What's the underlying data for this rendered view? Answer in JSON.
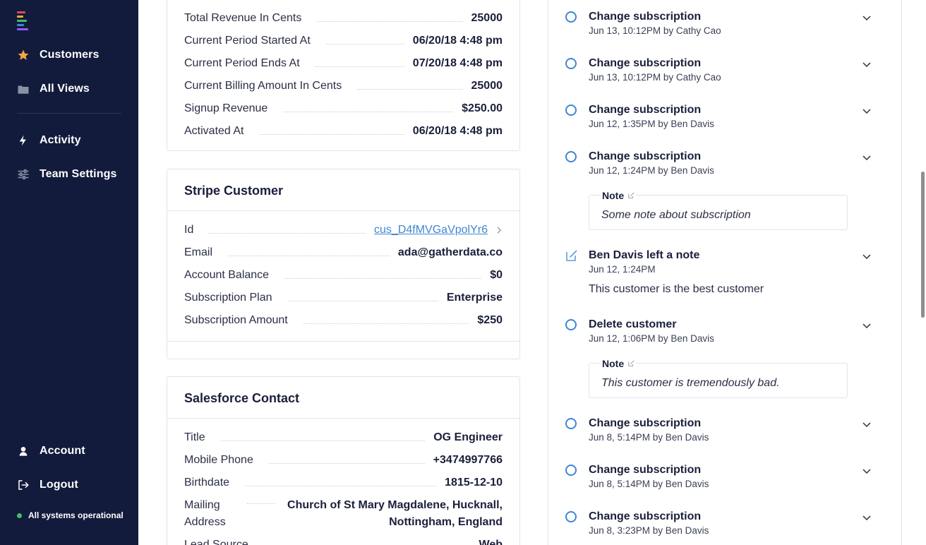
{
  "sidebar": {
    "nav": [
      {
        "label": "Customers",
        "icon": "star-icon"
      },
      {
        "label": "All Views",
        "icon": "folder-icon"
      },
      {
        "label": "Activity",
        "icon": "bolt-icon"
      },
      {
        "label": "Team Settings",
        "icon": "sliders-icon"
      }
    ],
    "account_label": "Account",
    "logout_label": "Logout",
    "status_text": "All systems operational",
    "colors": {
      "bg": "#131b3c",
      "status_dot": "#3fbf6a",
      "star": "#f4a93b"
    }
  },
  "subscription_card": {
    "rows": [
      {
        "key": "Total Revenue In Cents",
        "value": "25000"
      },
      {
        "key": "Current Period Started At",
        "value": "06/20/18 4:48 pm"
      },
      {
        "key": "Current Period Ends At",
        "value": "07/20/18 4:48 pm"
      },
      {
        "key": "Current Billing Amount In Cents",
        "value": "25000"
      },
      {
        "key": "Signup Revenue",
        "value": "$250.00"
      },
      {
        "key": "Activated At",
        "value": "06/20/18 4:48 pm"
      }
    ]
  },
  "stripe_card": {
    "title": "Stripe Customer",
    "rows": [
      {
        "key": "Id",
        "value": "cus_D4fMVGaVpolYr6"
      },
      {
        "key": "Email",
        "value": "ada@gatherdata.co"
      },
      {
        "key": "Account Balance",
        "value": "$0"
      },
      {
        "key": "Subscription Plan",
        "value": "Enterprise"
      },
      {
        "key": "Subscription Amount",
        "value": "$250"
      }
    ]
  },
  "salesforce_card": {
    "title": "Salesforce Contact",
    "rows": [
      {
        "key": "Title",
        "value": "OG Engineer"
      },
      {
        "key": "Mobile Phone",
        "value": "+3474997766"
      },
      {
        "key": "Birthdate",
        "value": "1815-12-10"
      },
      {
        "key": "Mailing",
        "key2": "Address",
        "value": "Church of St Mary Magdalene, Hucknall,",
        "value2": "Nottingham, England"
      },
      {
        "key": "Lead Source",
        "value": "Web"
      }
    ]
  },
  "timeline": {
    "accent": "#3f86d1",
    "items": [
      {
        "type": "event",
        "title": "Change subscription",
        "sub": "Jun 13, 10:12PM by Cathy Cao"
      },
      {
        "type": "event",
        "title": "Change subscription",
        "sub": "Jun 13, 10:12PM by Cathy Cao"
      },
      {
        "type": "event",
        "title": "Change subscription",
        "sub": "Jun 12, 1:35PM by Ben Davis"
      },
      {
        "type": "event",
        "title": "Change subscription",
        "sub": "Jun 12, 1:24PM by Ben Davis",
        "note_label": "Note",
        "note": "Some note about subscription"
      },
      {
        "type": "note",
        "title": "Ben Davis left a note",
        "sub": "Jun 12, 1:24PM",
        "body": "This customer is the best customer"
      },
      {
        "type": "event",
        "title": "Delete customer",
        "sub": "Jun 12, 1:06PM by Ben Davis",
        "note_label": "Note",
        "note": "This customer is tremendously bad."
      },
      {
        "type": "event",
        "title": "Change subscription",
        "sub": "Jun 8, 5:14PM by Ben Davis"
      },
      {
        "type": "event",
        "title": "Change subscription",
        "sub": "Jun 8, 5:14PM by Ben Davis"
      },
      {
        "type": "event",
        "title": "Change subscription",
        "sub": "Jun 8, 3:23PM by Ben Davis"
      }
    ]
  }
}
